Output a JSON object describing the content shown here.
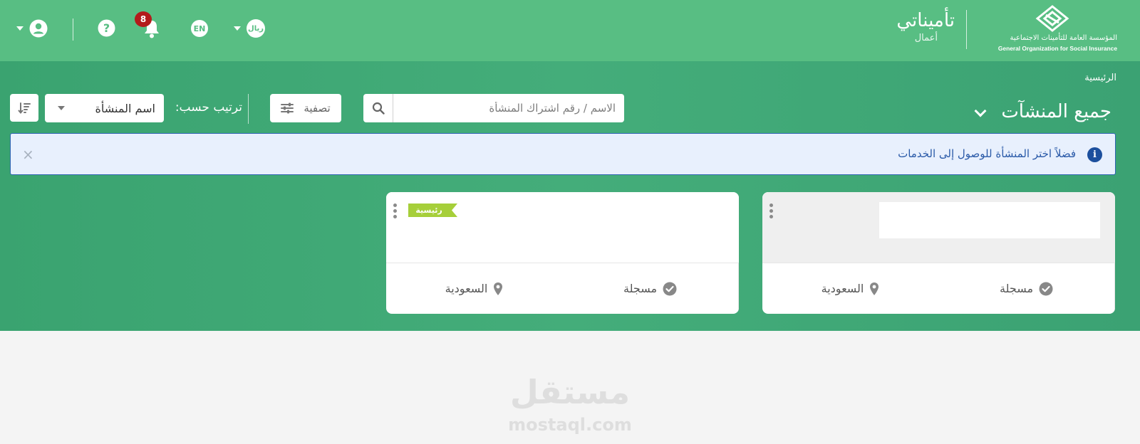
{
  "header": {
    "brand_name": "تأميناتي",
    "brand_sub": "أعمال",
    "logo_ar": "المؤسسة العامة للتأمينات الاجتماعية",
    "logo_en": "General Organization for Social Insurance",
    "currency_label": "ريال",
    "language_label": "EN",
    "notification_count": "8",
    "colors": {
      "background": "#58be83",
      "badge": "#b31b1b"
    }
  },
  "breadcrumb": "الرئيسية",
  "page_title": "جميع المنشآت",
  "search": {
    "placeholder": "الاسم / رقم اشتراك المنشأة",
    "value": ""
  },
  "filter_label": "تصفية",
  "sort": {
    "label": "ترتيب حسب:",
    "selected": "اسم المنشأة"
  },
  "alert": {
    "text": "فضلاً اختر المنشأة للوصول إلى الخدمات",
    "close_label": "×"
  },
  "cards": [
    {
      "country": "السعودية",
      "status": "مسجلة",
      "ribbon": ""
    },
    {
      "country": "السعودية",
      "status": "مسجلة",
      "ribbon": "رئيسية"
    }
  ],
  "watermark": {
    "ar": "مستقل",
    "en": "mostaql.com"
  },
  "theme": {
    "band_green": "#40a876",
    "ribbon_color": "#a6cf3a",
    "alert_blue": "#2f63b4"
  }
}
